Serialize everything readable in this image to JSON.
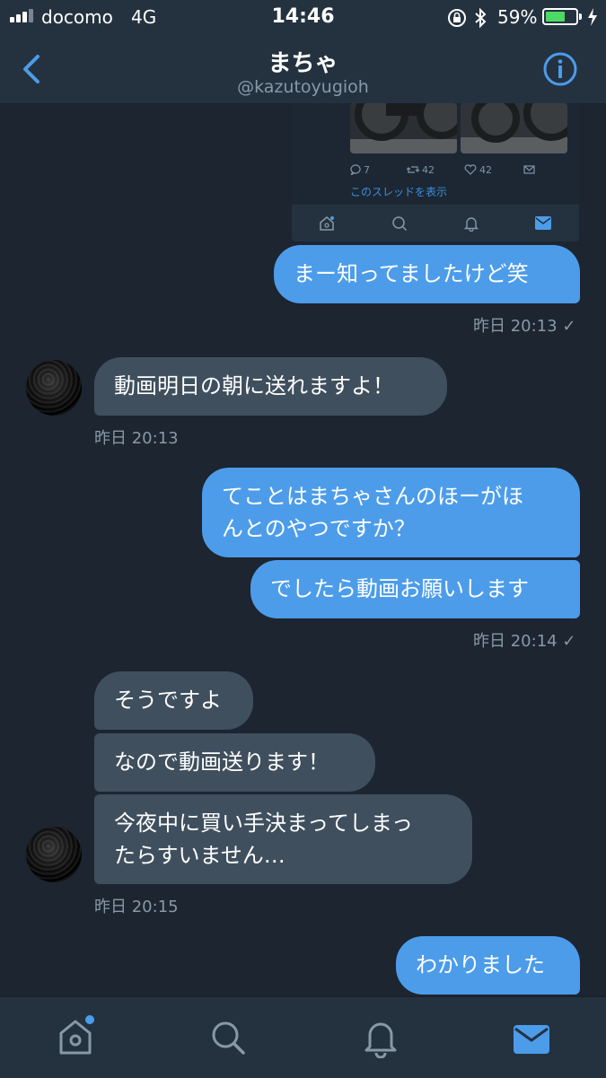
{
  "status_bar": {
    "carrier": "docomo",
    "network": "4G",
    "time": "14:46",
    "battery": "59%"
  },
  "header": {
    "title": "まちゃ",
    "handle": "@kazutoyugioh"
  },
  "embedded_tweet": {
    "reply_count": "7",
    "retweet_count": "42",
    "like_count": "42",
    "thread_link": "このスレッドを表示"
  },
  "messages": [
    {
      "id": "m1",
      "text": "まー知ってましたけど笑"
    },
    {
      "id": "m2",
      "text": "動画明日の朝に送れますよ！"
    },
    {
      "id": "m3_line1",
      "text": "てことはまちゃさんのほーがほ"
    },
    {
      "id": "m3_line2",
      "text": "んとのやつですか？"
    },
    {
      "id": "m4",
      "text": "でしたら動画お願いします"
    },
    {
      "id": "m5",
      "text": "そうですよ"
    },
    {
      "id": "m6",
      "text": "なので動画送ります！"
    },
    {
      "id": "m7_line1",
      "text": "今夜中に買い手決まってしまっ"
    },
    {
      "id": "m7_line2",
      "text": "たらすいません…"
    },
    {
      "id": "m8",
      "text": "わかりました"
    }
  ],
  "timestamps": {
    "t1": "昨日 20:13 ✓",
    "t2": "昨日 20:13",
    "t3": "昨日 20:14 ✓",
    "t4": "昨日 20:15"
  },
  "colors": {
    "outgoing_bubble": "#4c9cea",
    "incoming_bubble": "#3f4f5e",
    "background": "#1c2530",
    "accent": "#4c9cea"
  },
  "tabbar": [
    "home-icon",
    "search-icon",
    "notifications-icon",
    "messages-icon"
  ]
}
